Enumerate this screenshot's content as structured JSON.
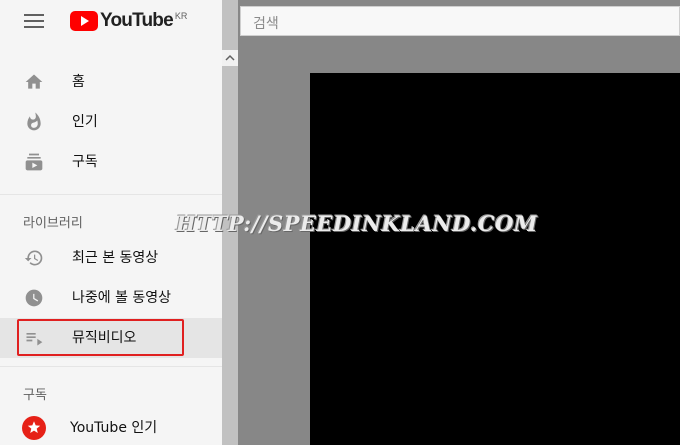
{
  "header": {
    "logo_text": "YouTube",
    "region": "KR",
    "search_placeholder": "검색"
  },
  "sidebar": {
    "main_items": [
      {
        "label": "홈",
        "icon": "home-icon"
      },
      {
        "label": "인기",
        "icon": "trending-icon"
      },
      {
        "label": "구독",
        "icon": "subscriptions-icon"
      }
    ],
    "library_title": "라이브러리",
    "library_items": [
      {
        "label": "최근 본 동영상",
        "icon": "history-icon"
      },
      {
        "label": "나중에 볼 동영상",
        "icon": "watch-later-icon"
      },
      {
        "label": "뮤직비디오",
        "icon": "playlist-icon"
      }
    ],
    "subscriptions_title": "구독",
    "subscription_items": [
      {
        "label": "YouTube 인기",
        "icon": "youtube-popular-channel-icon"
      }
    ]
  },
  "watermark": "HTTP://SPEEDINKLAND.COM",
  "colors": {
    "brand_red": "#ff0000",
    "highlight": "#e02020"
  }
}
